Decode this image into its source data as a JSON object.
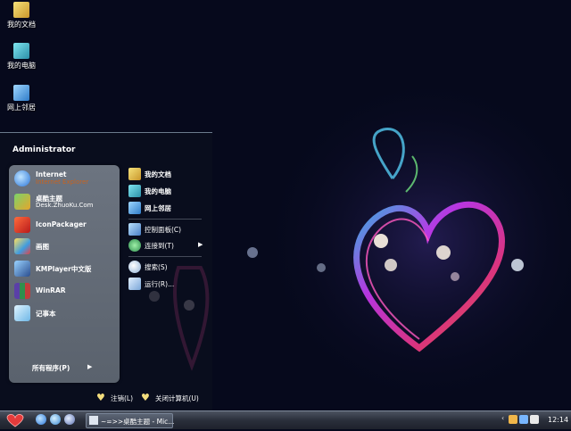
{
  "desktop": {
    "icons": [
      {
        "label": "我的文档",
        "icon": "my-documents-icon",
        "color": "#e7c24b"
      },
      {
        "label": "我的电脑",
        "icon": "my-computer-icon",
        "color": "#42b6c9"
      },
      {
        "label": "网上邻居",
        "icon": "network-places-icon",
        "color": "#5fb2e8"
      }
    ]
  },
  "start_menu": {
    "user": "Administrator",
    "left_items": [
      {
        "title": "Internet",
        "subtitle": "Internet Explorer",
        "icon": "internet-explorer-icon"
      },
      {
        "title": "桌酷主题",
        "subtitle": "Desk.ZhuoKu.Com",
        "icon": "zhuoku-theme-icon"
      },
      {
        "title": "IconPackager",
        "icon": "iconpackager-icon"
      },
      {
        "title": "画图",
        "icon": "paint-icon"
      },
      {
        "title": "KMPlayer中文版",
        "icon": "kmplayer-icon"
      },
      {
        "title": "WinRAR",
        "icon": "winrar-icon"
      },
      {
        "title": "记事本",
        "icon": "notepad-icon"
      }
    ],
    "all_programs": "所有程序(P)",
    "right_items": [
      {
        "label": "我的文档",
        "icon": "my-documents-icon"
      },
      {
        "label": "我的电脑",
        "icon": "my-computer-icon"
      },
      {
        "label": "网上邻居",
        "icon": "network-places-icon"
      },
      {
        "label": "控制面板(C)",
        "icon": "control-panel-icon"
      },
      {
        "label": "连接到(T)",
        "icon": "connect-to-icon"
      },
      {
        "label": "搜索(S)",
        "icon": "search-icon"
      },
      {
        "label": "运行(R)...",
        "icon": "run-icon"
      }
    ],
    "logoff": "注销(L)",
    "shutdown": "关闭计算机(U)"
  },
  "taskbar": {
    "task_label": "~=>>桌酷主题 - Mic...",
    "clock": "12:14"
  },
  "colors": {
    "accent": "#f3dd7d",
    "taskbar": "#2a2f3b"
  }
}
